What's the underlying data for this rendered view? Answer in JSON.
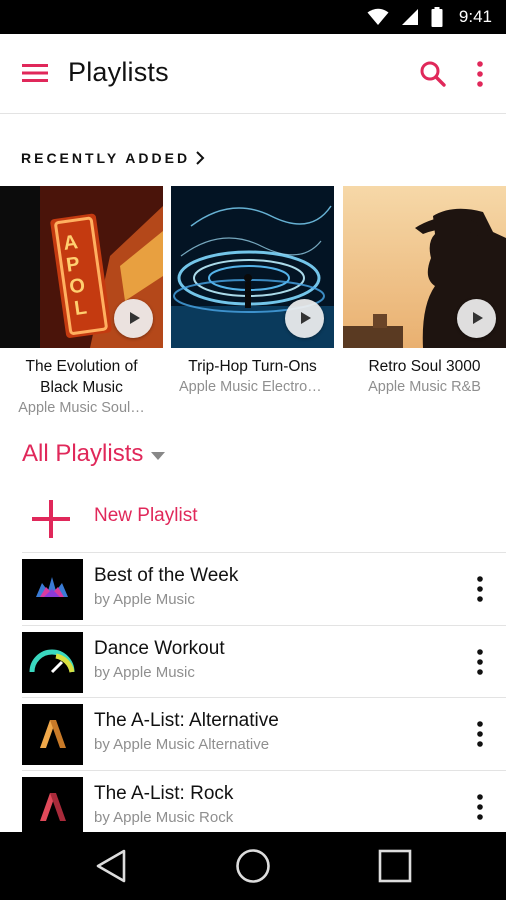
{
  "status_bar": {
    "time": "9:41",
    "icons": [
      "wifi-icon",
      "signal-icon",
      "battery-icon"
    ]
  },
  "app_bar": {
    "title": "Playlists",
    "icons": [
      "menu-icon",
      "search-icon",
      "more-vert-icon"
    ]
  },
  "recently_added": {
    "header": "RECENTLY ADDED",
    "items": [
      {
        "name": "The Evolution of Black Music",
        "subtitle": "Apple Music Soul…"
      },
      {
        "name": "Trip-Hop Turn-Ons",
        "subtitle": "Apple Music Electron…"
      },
      {
        "name": "Retro Soul 3000",
        "subtitle": "Apple Music R&B"
      }
    ]
  },
  "all_playlists": {
    "label": "All Playlists"
  },
  "new_playlist": {
    "label": "New Playlist"
  },
  "playlists": [
    {
      "title": "Best of the Week",
      "by": "by Apple Music"
    },
    {
      "title": "Dance Workout",
      "by": "by Apple Music"
    },
    {
      "title": "The A-List: Alternative",
      "by": "by Apple Music Alternative"
    },
    {
      "title": "The A-List: Rock",
      "by": "by Apple Music Rock"
    }
  ],
  "nav_bar": {
    "icons": [
      "back-icon",
      "home-icon",
      "recents-icon"
    ]
  },
  "colors": {
    "accent": "#e0285a",
    "secondary_text": "#8f8f8f",
    "divider": "#e3e3e3"
  }
}
